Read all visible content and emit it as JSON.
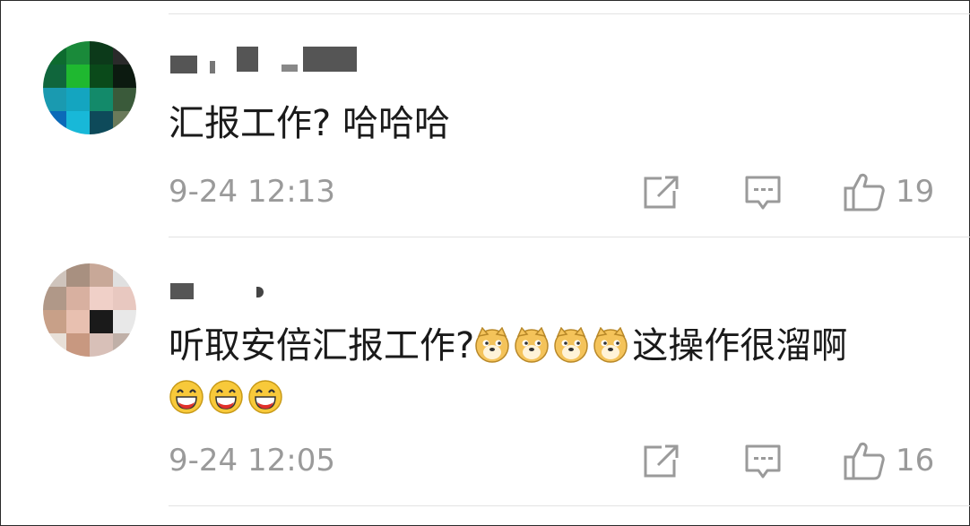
{
  "comments": [
    {
      "username": "",
      "text": "汇报工作? 哈哈哈",
      "emoji_after_text": [],
      "emoji_line2": [],
      "time": "9-24 12:13",
      "likes": "19",
      "avatar_colors": [
        "#0d6b2f",
        "#1a8a3a",
        "#2a2a2a",
        "#10663c",
        "#1fb830",
        "#0c3a1a",
        "#1a9ab0",
        "#14a5c0",
        "#138a6a",
        "#0b6ab8",
        "#18b8d8",
        "#0e4a5a"
      ]
    },
    {
      "username": "",
      "text": "听取安倍汇报工作?",
      "text_suffix": "这操作很溜啊",
      "emoji_after_text": [
        "doge-emoji",
        "doge-emoji",
        "doge-emoji",
        "doge-emoji"
      ],
      "emoji_line2": [
        "laugh-emoji",
        "laugh-emoji",
        "laugh-emoji"
      ],
      "time": "9-24 12:05",
      "likes": "16",
      "avatar_colors": [
        "#9a8070",
        "#c8a898",
        "#e8c8c0",
        "#d8b0a0",
        "#f0d0c8",
        "#202020",
        "#c8a088",
        "#e8c0b0",
        "#f0e0d8",
        "#a88878",
        "#d8c0b8",
        "#c0b0a8"
      ]
    }
  ],
  "icons": {
    "repost": "share-icon",
    "comment": "comment-icon",
    "like": "thumbs-up-icon"
  },
  "colors": {
    "text": "#1a1a1a",
    "meta": "#9a9a9a",
    "divider": "#e3e3e3"
  }
}
